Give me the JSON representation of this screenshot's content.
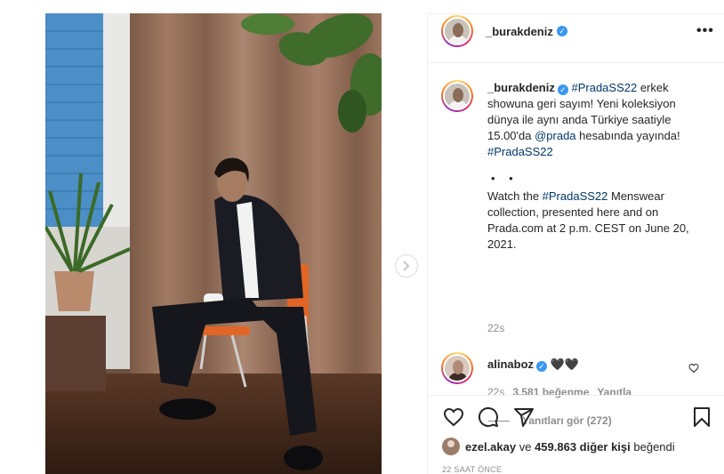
{
  "post": {
    "author": "_burakdeniz",
    "more_label": "•••",
    "caption_author": "_burakdeniz",
    "caption_part1": " ",
    "caption_tag1": "#PradaSS22",
    "caption_part2": " erkek showuna geri sayım! Yeni koleksiyon dünya ile aynı anda Türkiye saatiyle 15.00'da ",
    "caption_mention": "@prada",
    "caption_part3": " hesabında yayında! ",
    "caption_tag2": "#PradaSS22",
    "caption_dots": "• •",
    "caption_en1": "Watch the ",
    "caption_tag3": "#PradaSS22",
    "caption_en2": " Menswear collection, presented here and on Prada.com at 2 p.m. CEST on June 20, 2021.",
    "caption_time": "22s"
  },
  "comment": {
    "author": "alinaboz",
    "text": "🖤🖤",
    "time": "22s",
    "likes": "3.581 beğenme",
    "reply": "Yanıtla",
    "view_replies": "Yanıtları gör (272)"
  },
  "likes": {
    "first_user": "ezel.akay",
    "connector": " ve ",
    "others": "459.863 diğer kişi",
    "suffix": " beğendi"
  },
  "timestamp": "22 SAAT ÖNCE",
  "icons": {
    "heart": "heart-icon",
    "comment": "comment-icon",
    "share": "share-icon",
    "save": "bookmark-icon",
    "next": "chevron-right-icon",
    "verified": "verified-badge-icon"
  },
  "colors": {
    "link": "#00376b",
    "verified": "#3897f0",
    "muted": "#8e8e8e",
    "text": "#262626"
  }
}
